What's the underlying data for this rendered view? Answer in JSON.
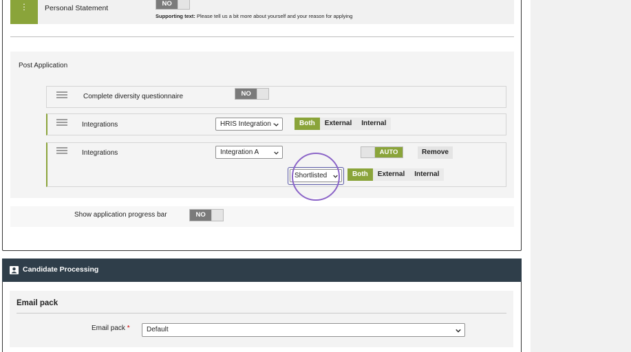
{
  "personal_statement": {
    "label": "Personal Statement",
    "toggle": "NO",
    "supporting_label": "Supporting text:",
    "supporting_text": "Please tell us a bit more about yourself and your reason for applying"
  },
  "post_application": {
    "title": "Post Application",
    "items": [
      {
        "label": "Complete diversity questionnaire",
        "toggle": "NO"
      },
      {
        "label": "Integrations",
        "select": "HRIS Integration -",
        "segments": [
          "Both",
          "External",
          "Internal"
        ],
        "active": "Both"
      },
      {
        "label": "Integrations",
        "select": "Integration A",
        "auto_toggle": "AUTO",
        "remove_label": "Remove",
        "status_select": "Shortlisted",
        "segments": [
          "Both",
          "External",
          "Internal"
        ],
        "active": "Both"
      }
    ]
  },
  "progress_bar": {
    "label": "Show application progress bar",
    "toggle": "NO"
  },
  "candidate_processing": {
    "title": "Candidate Processing",
    "email_pack_section": "Email pack",
    "email_pack_label": "Email pack",
    "required_mark": "*",
    "email_pack_value": "Default"
  },
  "colors": {
    "accent": "#8aa43a",
    "header": "#2f3e4a",
    "highlight": "#8a63c7"
  }
}
